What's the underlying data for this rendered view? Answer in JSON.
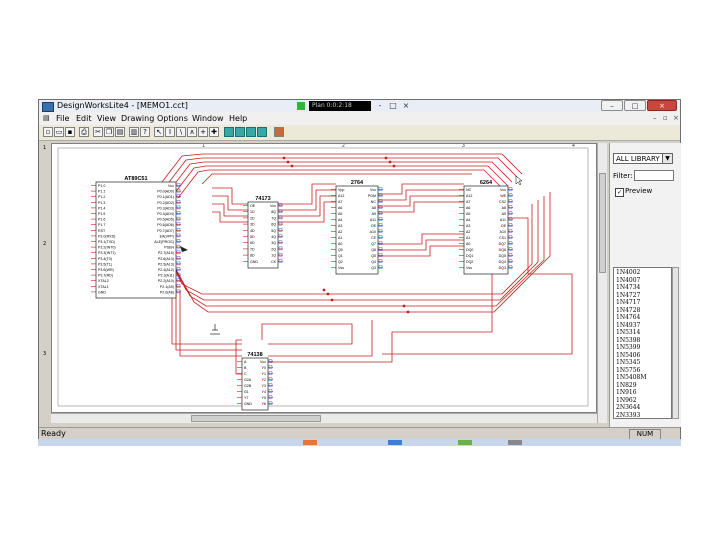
{
  "window": {
    "title": "DesignWorksLite4 - [MEMO1.cct]",
    "indicator_text": "Plan 0:0:2:18",
    "title_controls": [
      "-",
      "□",
      "×"
    ],
    "window_buttons": [
      "–",
      "□",
      "×"
    ]
  },
  "menubar": {
    "items": [
      "File",
      "Edit",
      "View",
      "Drawing",
      "Options",
      "Window",
      "Help"
    ],
    "mdi_controls": [
      "–",
      "▫",
      "×"
    ]
  },
  "toolbar": {
    "buttons": [
      "new",
      "open",
      "save",
      "print",
      "cut",
      "copy",
      "paste",
      "help",
      "pointer",
      "text",
      "wire",
      "zoom-in",
      "zoom-out",
      "probe",
      "sim",
      "sim2",
      "sim3",
      "sim4",
      "sim5",
      "lib"
    ]
  },
  "ruler": {
    "top": [
      "1",
      "2",
      "3",
      "4"
    ],
    "left": [
      "1",
      "2",
      "3"
    ]
  },
  "schematic": {
    "wire_color": "#c81e1e",
    "pin_color": "#1e3cc8",
    "chips": [
      {
        "name": "AT89C51",
        "left_pins": [
          "P1.0",
          "P1.1",
          "P1.2",
          "P1.3",
          "P1.4",
          "P1.5",
          "P1.6",
          "P1.7",
          "RST",
          "P3.0(RXD)",
          "P3.1(TXD)",
          "P3.2(INT0)",
          "P3.3(INT1)",
          "P3.4(T0)",
          "P3.5(T1)",
          "P3.6(WR)",
          "P3.7(RD)",
          "XTAL2",
          "XTAL1",
          "GND"
        ],
        "right_pins": [
          "Vcc",
          "P0.0(AD0)",
          "P0.1(AD1)",
          "P0.2(AD2)",
          "P0.3(AD3)",
          "P0.4(AD4)",
          "P0.5(AD5)",
          "P0.6(AD6)",
          "P0.7(AD7)",
          "EA(VPP)",
          "ALE(PROG)",
          "PSEN",
          "P2.7(A15)",
          "P2.6(A14)",
          "P2.5(A13)",
          "P2.4(A12)",
          "P2.3(A11)",
          "P2.2(A10)",
          "P2.1(A9)",
          "P2.0(A8)"
        ]
      },
      {
        "name": "74173",
        "left_pins": [
          "OE",
          "1D",
          "2D",
          "3D",
          "4D",
          "5D",
          "6D",
          "7D",
          "8D",
          "GND"
        ],
        "right_pins": [
          "Vcc",
          "8Q",
          "7Q",
          "6Q",
          "5Q",
          "4Q",
          "3Q",
          "2Q",
          "1Q",
          "CK"
        ]
      },
      {
        "name": "2764",
        "left_pins": [
          "Vpp",
          "A12",
          "A7",
          "A6",
          "A5",
          "A4",
          "A3",
          "A2",
          "A1",
          "A0",
          "Q0",
          "Q1",
          "Q2",
          "Vss"
        ],
        "right_pins": [
          "Vcc",
          "PGM",
          "NC",
          "A8",
          "A9",
          "A11",
          "OE",
          "A10",
          "CE",
          "Q7",
          "Q6",
          "Q5",
          "Q4",
          "Q3"
        ]
      },
      {
        "name": "6264",
        "left_pins": [
          "NC",
          "A12",
          "A7",
          "A6",
          "A5",
          "A4",
          "A3",
          "A2",
          "A1",
          "A0",
          "DQ0",
          "DQ1",
          "DQ2",
          "Vss"
        ],
        "right_pins": [
          "Vcc",
          "WE",
          "CS2",
          "A8",
          "A9",
          "A11",
          "OE",
          "A10",
          "CS1",
          "DQ7",
          "DQ6",
          "DQ5",
          "DQ4",
          "DQ3"
        ]
      },
      {
        "name": "74138",
        "left_pins": [
          "A",
          "B",
          "C",
          "G2A",
          "G2B",
          "G1",
          "Y7",
          "GND"
        ],
        "right_pins": [
          "Vcc",
          "Y0",
          "Y1",
          "Y2",
          "Y3",
          "Y4",
          "Y5",
          "Y6"
        ]
      }
    ]
  },
  "library_panel": {
    "selected_library": "ALL LIBRARY",
    "filter_label": "Filter:",
    "filter_value": "",
    "preview_label": "Preview",
    "preview_checked": true,
    "parts": [
      "1N4002",
      "1N4007",
      "1N4734",
      "1N4727",
      "1N4717",
      "1N4728",
      "1N4764",
      "1N4937",
      "1N5314",
      "1N5398",
      "1N5399",
      "1N5406",
      "1N5345",
      "1N5756",
      "1N5408M",
      "1N829",
      "1N916",
      "1N962",
      "2N3644",
      "2N3393"
    ]
  },
  "statusbar": {
    "status": "Ready",
    "num_indicator": "NUM"
  }
}
